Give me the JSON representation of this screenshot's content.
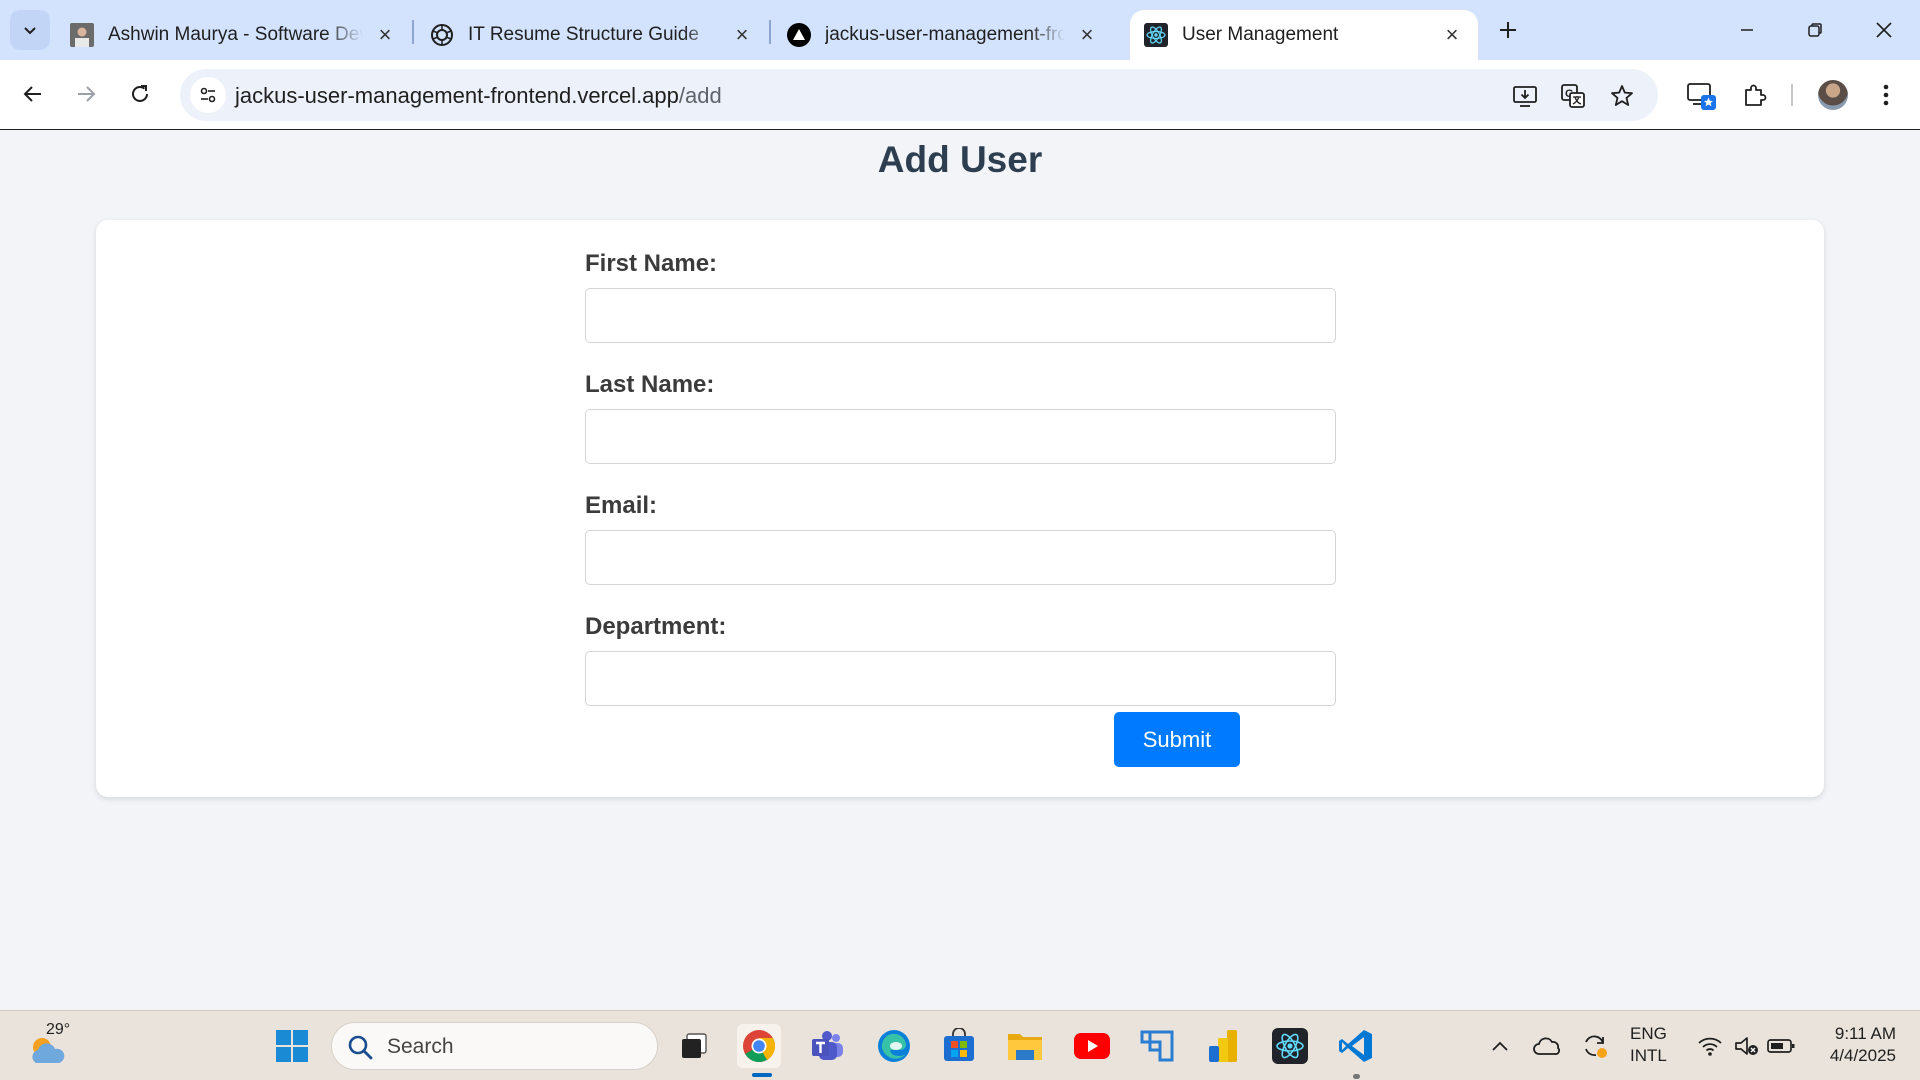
{
  "browser": {
    "tabs": [
      {
        "title": "Ashwin Maurya - Software Deve",
        "favicon": "profile-photo-icon"
      },
      {
        "title": "IT Resume Structure Guide",
        "favicon": "chatgpt-icon"
      },
      {
        "title": "jackus-user-management-front",
        "favicon": "vercel-icon"
      },
      {
        "title": "User Management",
        "favicon": "react-icon",
        "active": true
      }
    ],
    "address": {
      "host": "jackus-user-management-frontend.vercel.app",
      "path": "/add"
    }
  },
  "page": {
    "title": "Add User",
    "form": {
      "fields": [
        {
          "label": "First Name:",
          "value": ""
        },
        {
          "label": "Last Name:",
          "value": ""
        },
        {
          "label": "Email:",
          "value": ""
        },
        {
          "label": "Department:",
          "value": ""
        }
      ],
      "submit_label": "Submit"
    }
  },
  "taskbar": {
    "weather_temp": "29°",
    "search_placeholder": "Search",
    "language": {
      "line1": "ENG",
      "line2": "INTL"
    },
    "time": "9:11 AM",
    "date": "4/4/2025"
  },
  "colors": {
    "accent": "#007bff",
    "title": "#2c3e50",
    "tabstrip": "#d3e3fd"
  }
}
